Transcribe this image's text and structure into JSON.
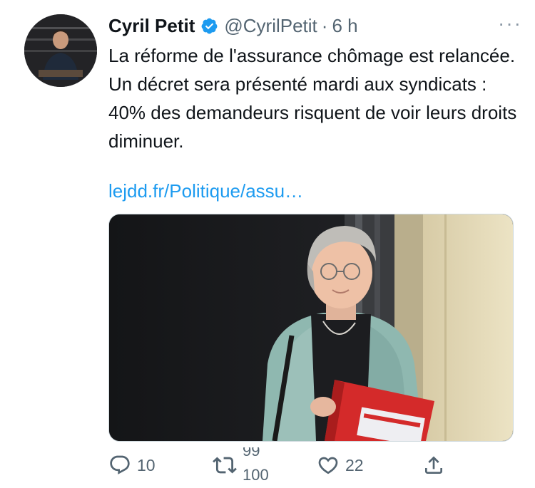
{
  "tweet": {
    "author_name": "Cyril Petit",
    "handle": "@CyrilPetit",
    "separator": "·",
    "time": "6 h",
    "more_label": "···",
    "text": "La réforme de l'assurance chômage est relancée. Un décret sera présenté mardi aux syndicats : 40% des demandeurs risquent de voir leurs droits diminuer.",
    "link_text": "lejdd.fr/Politique/assu…"
  },
  "actions": {
    "reply_count": "10",
    "retweet_count_prev": "99",
    "retweet_count_next": "100",
    "like_count": "22"
  },
  "icons": {
    "verified": "verified-badge-icon",
    "reply": "reply-icon",
    "retweet": "retweet-icon",
    "like": "heart-icon",
    "share": "share-icon",
    "more": "more-icon"
  },
  "colors": {
    "accent": "#1d9bf0",
    "text": "#0f1419",
    "secondary": "#536471"
  }
}
